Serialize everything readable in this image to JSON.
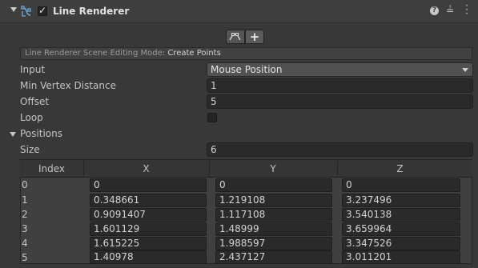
{
  "component": {
    "title": "Line Renderer",
    "enabled": true,
    "icons": [
      "fold-arrow-icon",
      "line-renderer-icon",
      "help-icon",
      "presets-icon",
      "more-icon"
    ]
  },
  "edit_buttons": {
    "add_label": "+"
  },
  "mode_bar": {
    "label": "Line Renderer Scene Editing Mode:",
    "value": "Create Points"
  },
  "properties": {
    "input_label": "Input",
    "input_value": "Mouse Position",
    "min_vertex_label": "Min Vertex Distance",
    "min_vertex_value": "1",
    "offset_label": "Offset",
    "offset_value": "5",
    "loop_label": "Loop",
    "loop_checked": false,
    "positions_label": "Positions",
    "size_label": "Size",
    "size_value": "6"
  },
  "table": {
    "headers": [
      "Index",
      "X",
      "Y",
      "Z"
    ],
    "rows": [
      [
        "0",
        "0",
        "0",
        "0"
      ],
      [
        "1",
        "0.348661",
        "1.219108",
        "3.237496"
      ],
      [
        "2",
        "0.9091407",
        "1.117108",
        "3.540138"
      ],
      [
        "3",
        "1.601129",
        "1.48999",
        "3.659964"
      ],
      [
        "4",
        "1.615225",
        "1.988597",
        "3.347526"
      ],
      [
        "5",
        "1.40978",
        "2.437127",
        "3.011201"
      ]
    ]
  }
}
